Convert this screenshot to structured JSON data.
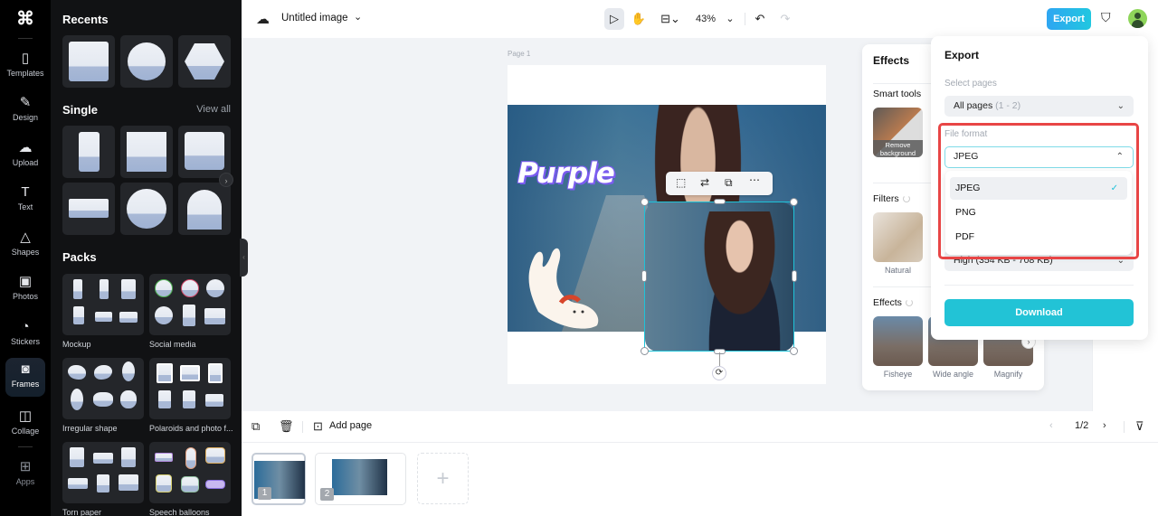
{
  "rail": {
    "items": [
      {
        "label": "Templates",
        "icon": "templates-icon"
      },
      {
        "label": "Design",
        "icon": "design-icon"
      },
      {
        "label": "Upload",
        "icon": "upload-icon"
      },
      {
        "label": "Text",
        "icon": "text-icon"
      },
      {
        "label": "Shapes",
        "icon": "shapes-icon"
      },
      {
        "label": "Photos",
        "icon": "photos-icon"
      },
      {
        "label": "Stickers",
        "icon": "stickers-icon"
      },
      {
        "label": "Frames",
        "icon": "frames-icon",
        "active": true
      },
      {
        "label": "Collage",
        "icon": "collage-icon"
      },
      {
        "label": "Apps",
        "icon": "apps-icon"
      }
    ]
  },
  "panel": {
    "recents_title": "Recents",
    "single_title": "Single",
    "view_all": "View all",
    "packs_title": "Packs",
    "packs": [
      {
        "label": "Mockup"
      },
      {
        "label": "Social media"
      },
      {
        "label": "Irregular shape"
      },
      {
        "label": "Polaroids and photo f..."
      },
      {
        "label": "Torn paper"
      },
      {
        "label": "Speech balloons"
      }
    ]
  },
  "topbar": {
    "doc_title": "Untitled image",
    "zoom": "43%",
    "export_label": "Export"
  },
  "canvas": {
    "page_label": "Page 1",
    "text_element": "Purple"
  },
  "effects": {
    "title": "Effects",
    "smart_tools": "Smart tools",
    "remove_bg": "Remove background",
    "filters": "Filters",
    "filter_items": [
      "Natural"
    ],
    "effects_label": "Effects",
    "effect_items": [
      "Fisheye",
      "Wide angle",
      "Magnify"
    ]
  },
  "export": {
    "title": "Export",
    "select_pages_label": "Select pages",
    "pages_value": "All pages",
    "pages_range": "(1 - 2)",
    "file_format_label": "File format",
    "file_format_value": "JPEG",
    "options": [
      "JPEG",
      "PNG",
      "PDF"
    ],
    "selected_option": "JPEG",
    "quality_hidden": "High (354 KB - 708 KB)",
    "download_label": "Download",
    "accent": "#22c3d6",
    "highlight": "#e84545"
  },
  "bottom": {
    "add_page": "Add page",
    "page_counter": "1/2",
    "thumbs": [
      "1",
      "2"
    ]
  }
}
